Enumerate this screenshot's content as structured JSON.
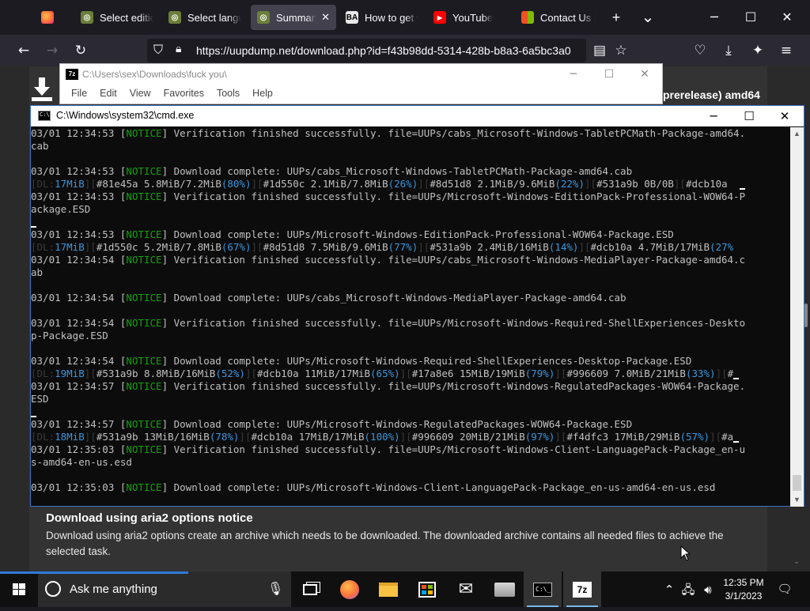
{
  "browser": {
    "tabs": [
      {
        "title": "",
        "favicon": "firefox-icon"
      },
      {
        "title": "Select editio",
        "favicon": "uup-icon"
      },
      {
        "title": "Select langu",
        "favicon": "uup-icon"
      },
      {
        "title": "Summary",
        "favicon": "uup-icon",
        "active": true
      },
      {
        "title": "How to get w",
        "favicon": "ba-icon"
      },
      {
        "title": "YouTube",
        "favicon": "youtube-icon"
      },
      {
        "title": "Contact Us |",
        "favicon": "microsoft-icon"
      }
    ],
    "new_tab": "+",
    "list_all": "⌄",
    "win_min": "─",
    "win_max": "☐",
    "win_close": "✕",
    "url": "https://uupdump.net/download.php?id=f43b98dd-5314-428b-b8a3-6a5bc3a0",
    "url_host": "uupdump.net"
  },
  "page": {
    "title_fragment": "prerelease) amd64",
    "notice_title": "Download using aria2 options notice",
    "notice_body": "Download using aria2 options create an archive which needs to be downloaded. The downloaded archive contains all needed files to achieve the selected task."
  },
  "sevenzip": {
    "title": "C:\\Users\\sex\\Downloads\\fuck you\\",
    "menu": [
      "File",
      "Edit",
      "View",
      "Favorites",
      "Tools",
      "Help"
    ],
    "min": "─",
    "max": "☐",
    "close": "✕"
  },
  "cmd": {
    "title": "C:\\Windows\\system32\\cmd.exe",
    "min": "─",
    "max": "☐",
    "close": "✕",
    "lines": [
      [
        {
          "t": "03/01 12:34:53 ["
        },
        {
          "t": "NOTICE",
          "c": "g"
        },
        {
          "t": "] Verification finished successfully. file=UUPs/cabs_Microsoft-Windows-TabletPCMath-Package-amd64."
        }
      ],
      [
        {
          "t": "cab"
        }
      ],
      [
        {
          "t": ""
        }
      ],
      [
        {
          "t": "03/01 12:34:53 ["
        },
        {
          "t": "NOTICE",
          "c": "g"
        },
        {
          "t": "] Download complete: UUPs/cabs_Microsoft-Windows-TabletPCMath-Package-amd64.cab"
        }
      ],
      [
        {
          "t": "[",
          "c": "bar"
        },
        {
          "t": "DL:",
          "c": "bar"
        },
        {
          "t": "17MiB",
          "c": "c"
        },
        {
          "t": "][",
          "c": "bar"
        },
        {
          "t": "#81e45a 5.8MiB/7.2MiB"
        },
        {
          "t": "(80%)",
          "c": "c"
        },
        {
          "t": "][",
          "c": "bar"
        },
        {
          "t": "#1d550c 2.1MiB/7.8MiB"
        },
        {
          "t": "(26%)",
          "c": "c"
        },
        {
          "t": "][",
          "c": "bar"
        },
        {
          "t": "#8d51d8 2.1MiB/9.6MiB"
        },
        {
          "t": "(22%)",
          "c": "c"
        },
        {
          "t": "][",
          "c": "bar"
        },
        {
          "t": "#531a9b 0B/0B"
        },
        {
          "t": "][",
          "c": "bar"
        },
        {
          "t": "#dcb10a"
        },
        {
          "t": "  "
        },
        {
          "t": "CUR"
        }
      ],
      [
        {
          "t": "03/01 12:34:53 ["
        },
        {
          "t": "NOTICE",
          "c": "g"
        },
        {
          "t": "] Verification finished successfully. file=UUPs/Microsoft-Windows-EditionPack-Professional-WOW64-P"
        }
      ],
      [
        {
          "t": "ackage.ESD"
        }
      ],
      [
        {
          "t": "CUR"
        }
      ],
      [
        {
          "t": "03/01 12:34:53 ["
        },
        {
          "t": "NOTICE",
          "c": "g"
        },
        {
          "t": "] Download complete: UUPs/Microsoft-Windows-EditionPack-Professional-WOW64-Package.ESD"
        }
      ],
      [
        {
          "t": "[",
          "c": "bar"
        },
        {
          "t": "DL:",
          "c": "bar"
        },
        {
          "t": "17MiB",
          "c": "c"
        },
        {
          "t": "][",
          "c": "bar"
        },
        {
          "t": "#1d550c 5.2MiB/7.8MiB"
        },
        {
          "t": "(67%)",
          "c": "c"
        },
        {
          "t": "][",
          "c": "bar"
        },
        {
          "t": "#8d51d8 7.5MiB/9.6MiB"
        },
        {
          "t": "(77%)",
          "c": "c"
        },
        {
          "t": "][",
          "c": "bar"
        },
        {
          "t": "#531a9b 2.4MiB/16MiB"
        },
        {
          "t": "(14%)",
          "c": "c"
        },
        {
          "t": "][",
          "c": "bar"
        },
        {
          "t": "#dcb10a 4.7MiB/17MiB"
        },
        {
          "t": "(27%",
          "c": "c"
        }
      ],
      [
        {
          "t": "03/01 12:34:54 ["
        },
        {
          "t": "NOTICE",
          "c": "g"
        },
        {
          "t": "] Verification finished successfully. file=UUPs/cabs_Microsoft-Windows-MediaPlayer-Package-amd64.c"
        }
      ],
      [
        {
          "t": "ab"
        }
      ],
      [
        {
          "t": ""
        }
      ],
      [
        {
          "t": "03/01 12:34:54 ["
        },
        {
          "t": "NOTICE",
          "c": "g"
        },
        {
          "t": "] Download complete: UUPs/cabs_Microsoft-Windows-MediaPlayer-Package-amd64.cab"
        }
      ],
      [
        {
          "t": ""
        }
      ],
      [
        {
          "t": "03/01 12:34:54 ["
        },
        {
          "t": "NOTICE",
          "c": "g"
        },
        {
          "t": "] Verification finished successfully. file=UUPs/Microsoft-Windows-Required-ShellExperiences-Deskto"
        }
      ],
      [
        {
          "t": "p-Package.ESD"
        }
      ],
      [
        {
          "t": ""
        }
      ],
      [
        {
          "t": "03/01 12:34:54 ["
        },
        {
          "t": "NOTICE",
          "c": "g"
        },
        {
          "t": "] Download complete: UUPs/Microsoft-Windows-Required-ShellExperiences-Desktop-Package.ESD"
        }
      ],
      [
        {
          "t": "[",
          "c": "bar"
        },
        {
          "t": "DL:",
          "c": "bar"
        },
        {
          "t": "19MiB",
          "c": "c"
        },
        {
          "t": "][",
          "c": "bar"
        },
        {
          "t": "#531a9b 8.8MiB/16MiB"
        },
        {
          "t": "(52%)",
          "c": "c"
        },
        {
          "t": "][",
          "c": "bar"
        },
        {
          "t": "#dcb10a 11MiB/17MiB"
        },
        {
          "t": "(65%)",
          "c": "c"
        },
        {
          "t": "][",
          "c": "bar"
        },
        {
          "t": "#17a8e6 15MiB/19MiB"
        },
        {
          "t": "(79%)",
          "c": "c"
        },
        {
          "t": "][",
          "c": "bar"
        },
        {
          "t": "#996609 7.0MiB/21MiB"
        },
        {
          "t": "(33%)",
          "c": "c"
        },
        {
          "t": "][",
          "c": "bar"
        },
        {
          "t": "#"
        },
        {
          "t": "CUR"
        }
      ],
      [
        {
          "t": "03/01 12:34:57 ["
        },
        {
          "t": "NOTICE",
          "c": "g"
        },
        {
          "t": "] Verification finished successfully. file=UUPs/Microsoft-Windows-RegulatedPackages-WOW64-Package."
        }
      ],
      [
        {
          "t": "ESD"
        }
      ],
      [
        {
          "t": "CUR"
        }
      ],
      [
        {
          "t": "03/01 12:34:57 ["
        },
        {
          "t": "NOTICE",
          "c": "g"
        },
        {
          "t": "] Download complete: UUPs/Microsoft-Windows-RegulatedPackages-WOW64-Package.ESD"
        }
      ],
      [
        {
          "t": "[",
          "c": "bar"
        },
        {
          "t": "DL:",
          "c": "bar"
        },
        {
          "t": "18MiB",
          "c": "c"
        },
        {
          "t": "][",
          "c": "bar"
        },
        {
          "t": "#531a9b 13MiB/16MiB"
        },
        {
          "t": "(78%)",
          "c": "c"
        },
        {
          "t": "][",
          "c": "bar"
        },
        {
          "t": "#dcb10a 17MiB/17MiB"
        },
        {
          "t": "(100%)",
          "c": "c"
        },
        {
          "t": "][",
          "c": "bar"
        },
        {
          "t": "#996609 20MiB/21MiB"
        },
        {
          "t": "(97%)",
          "c": "c"
        },
        {
          "t": "][",
          "c": "bar"
        },
        {
          "t": "#f4dfc3 17MiB/29MiB"
        },
        {
          "t": "(57%)",
          "c": "c"
        },
        {
          "t": "][",
          "c": "bar"
        },
        {
          "t": "#a"
        },
        {
          "t": "CUR"
        }
      ],
      [
        {
          "t": "03/01 12:35:03 ["
        },
        {
          "t": "NOTICE",
          "c": "g"
        },
        {
          "t": "] Verification finished successfully. file=UUPs/Microsoft-Windows-Client-LanguagePack-Package_en-u"
        }
      ],
      [
        {
          "t": "s-amd64-en-us.esd"
        }
      ],
      [
        {
          "t": ""
        }
      ],
      [
        {
          "t": "03/01 12:35:03 ["
        },
        {
          "t": "NOTICE",
          "c": "g"
        },
        {
          "t": "] Download complete: UUPs/Microsoft-Windows-Client-LanguagePack-Package_en-us-amd64-en-us.esd"
        }
      ],
      [
        {
          "t": ""
        }
      ],
      [
        {
          "t": "CUR"
        }
      ]
    ]
  },
  "taskbar": {
    "search_placeholder": "Ask me anything",
    "apps": [
      "firefox-icon",
      "file-explorer-icon",
      "store-icon",
      "mail-icon",
      "installer-icon",
      "cmd-icon",
      "7zip-icon"
    ],
    "time": "12:35 PM",
    "date": "3/1/2023"
  },
  "colors": {
    "notice_green": "#13a10e",
    "progress_cyan": "#3a96dd",
    "accent_blue": "#2e7ad6"
  }
}
